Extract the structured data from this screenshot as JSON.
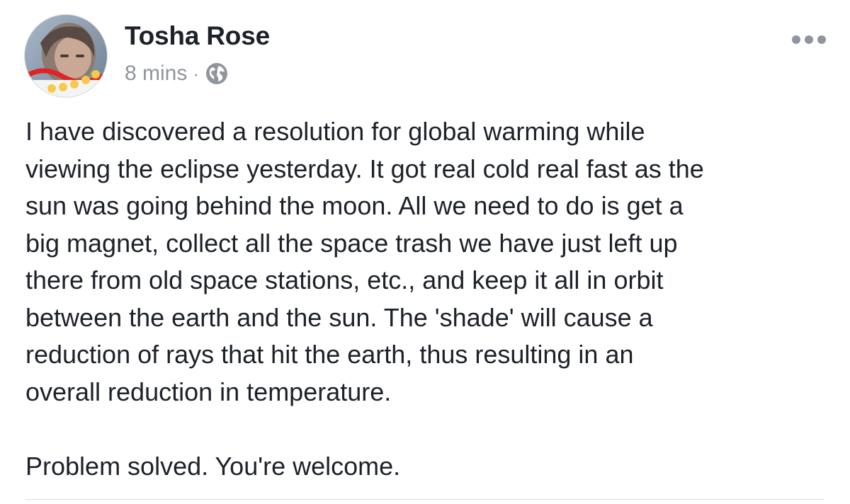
{
  "post": {
    "author": "Tosha Rose",
    "timestamp": "8 mins",
    "separator": "·",
    "privacy_icon": "globe-icon",
    "more_icon": "more-options-icon",
    "body_lines": [
      "I have discovered a resolution for global warming while",
      "viewing the eclipse yesterday. It got real cold real fast as the",
      "sun was going behind the moon. All we need to do is get a",
      "big magnet, collect all the space trash we have just left up",
      "there from old space stations, etc., and keep it all in orbit",
      "between the earth and the sun. The 'shade' will cause a",
      "reduction of rays that hit the earth, thus resulting in an",
      "overall reduction in temperature."
    ],
    "closing_line": "Problem solved. You're welcome."
  },
  "colors": {
    "text": "#1d2129",
    "secondary": "#90949c",
    "divider": "#dddfe2"
  }
}
